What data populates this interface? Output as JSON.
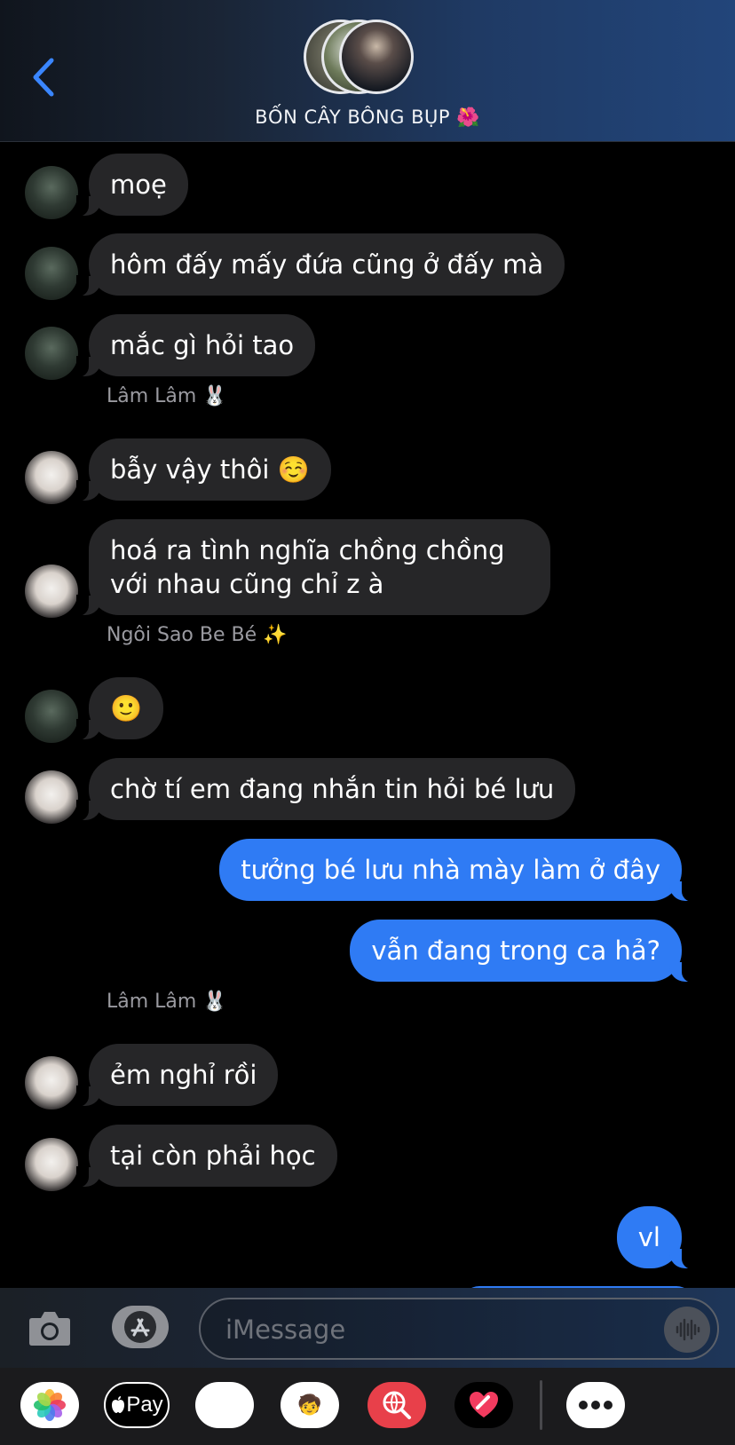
{
  "header": {
    "title": "BỐN CÂY BÔNG BỤP 🌺",
    "back_icon": "chevron-left-icon"
  },
  "messages": [
    {
      "type": "in",
      "avatar": "dark",
      "text": "moẹ"
    },
    {
      "type": "in",
      "avatar": "dark",
      "text": "hôm đấy mấy đứa cũng ở đấy mà"
    },
    {
      "type": "in",
      "avatar": "dark",
      "text": "mắc gì hỏi tao"
    },
    {
      "type": "sender",
      "text": "Lâm Lâm 🐰"
    },
    {
      "type": "in",
      "avatar": "light",
      "text": "bẫy vậy thôi ☺️"
    },
    {
      "type": "in",
      "avatar": "light",
      "text": "hoá ra tình nghĩa chồng chồng với nhau cũng chỉ z à"
    },
    {
      "type": "sender",
      "text": "Ngôi Sao Be Bé ✨"
    },
    {
      "type": "in",
      "avatar": "dark",
      "text": "🙂"
    },
    {
      "type": "in",
      "avatar": "light",
      "text": "chờ tí em đang nhắn tin hỏi bé lưu"
    },
    {
      "type": "out",
      "text": "tưởng bé lưu nhà mày làm ở đây"
    },
    {
      "type": "out",
      "text": "vẫn đang trong ca hả?"
    },
    {
      "type": "sender",
      "text": "Lâm Lâm 🐰"
    },
    {
      "type": "in",
      "avatar": "light",
      "text": "ẻm nghỉ rồi"
    },
    {
      "type": "in",
      "avatar": "light",
      "text": "tại còn phải học"
    },
    {
      "type": "out",
      "text": "vl"
    }
  ],
  "input": {
    "placeholder": "iMessage"
  },
  "apps": {
    "photos": "photos-icon",
    "apple_pay_label": "Pay",
    "animoji": "🐵",
    "memoji": "🧒",
    "search": "globe-search-icon",
    "digital_touch": "heart-icon",
    "more": "more-icon"
  },
  "colors": {
    "outgoing_bubble": "#2f7bf4",
    "incoming_bubble": "#262628",
    "background": "#000000"
  }
}
